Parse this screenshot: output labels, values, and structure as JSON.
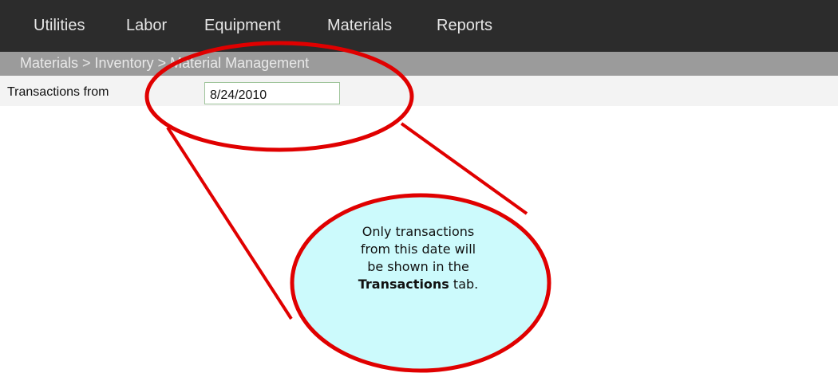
{
  "menu": {
    "items": [
      {
        "label": "Utilities"
      },
      {
        "label": "Labor"
      },
      {
        "label": "Equipment"
      },
      {
        "label": "Materials"
      },
      {
        "label": "Reports"
      }
    ]
  },
  "breadcrumb": {
    "text": "Materials > Inventory > Material Management"
  },
  "filter": {
    "label": "Transactions from",
    "date_value": "8/24/2010"
  },
  "callout": {
    "line1": "Only transactions",
    "line2": "from this date will",
    "line3": "be shown in the",
    "bold_word": "Transactions",
    "line4_suffix": " tab."
  },
  "colors": {
    "menubar_bg": "#2c2c2c",
    "breadcrumb_bg": "#9b9b9b",
    "callout_outline": "#e00000",
    "callout_fill": "#ccfafc"
  }
}
